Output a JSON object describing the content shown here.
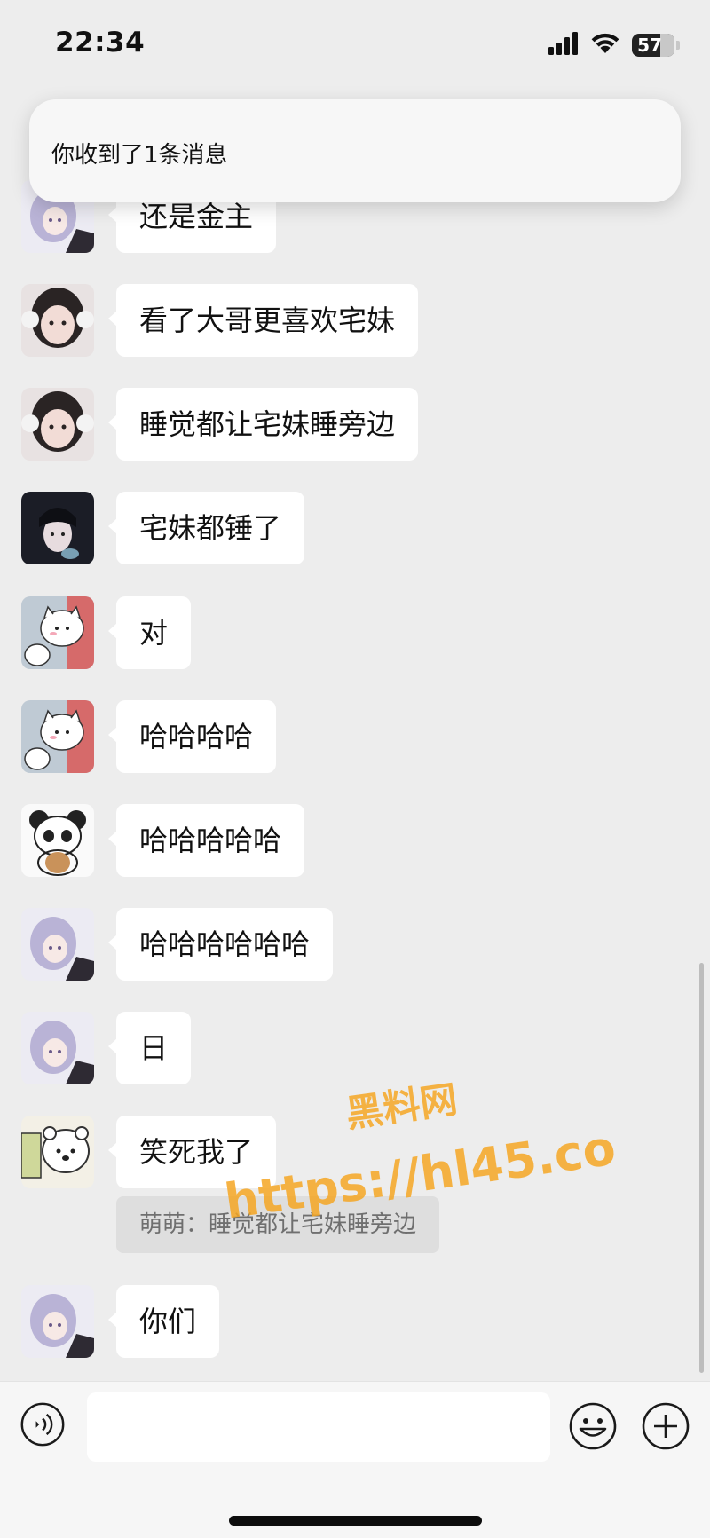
{
  "status_bar": {
    "time": "22:34",
    "battery": "57"
  },
  "notification": {
    "text": "你收到了1条消息"
  },
  "messages": [
    {
      "text": "还是金主",
      "avatar": "anime-girl-avatar"
    },
    {
      "text": "看了大哥更喜欢宅妹",
      "avatar": "girl-photo-avatar"
    },
    {
      "text": "睡觉都让宅妹睡旁边",
      "avatar": "girl-photo-avatar"
    },
    {
      "text": "宅妹都锤了",
      "avatar": "dark-hair-girl-avatar"
    },
    {
      "text": "对",
      "avatar": "cartoon-cat-avatar"
    },
    {
      "text": "哈哈哈哈",
      "avatar": "cartoon-cat-avatar"
    },
    {
      "text": "哈哈哈哈哈",
      "avatar": "panda-avatar"
    },
    {
      "text": "哈哈哈哈哈哈",
      "avatar": "anime-girl-avatar"
    },
    {
      "text": "日",
      "avatar": "anime-girl-avatar"
    },
    {
      "text": "笑死我了",
      "avatar": "bear-cartoon-avatar"
    },
    {
      "text": "你们",
      "avatar": "anime-girl-avatar"
    }
  ],
  "quote": {
    "text": "萌萌：睡觉都让宅妹睡旁边"
  },
  "watermark": {
    "line1": "黑料网",
    "line2": "https://hl45.co"
  },
  "input": {
    "value": "",
    "placeholder": ""
  },
  "colors": {
    "background": "#ededed",
    "bubble": "#ffffff",
    "watermark": "#f5a623"
  }
}
